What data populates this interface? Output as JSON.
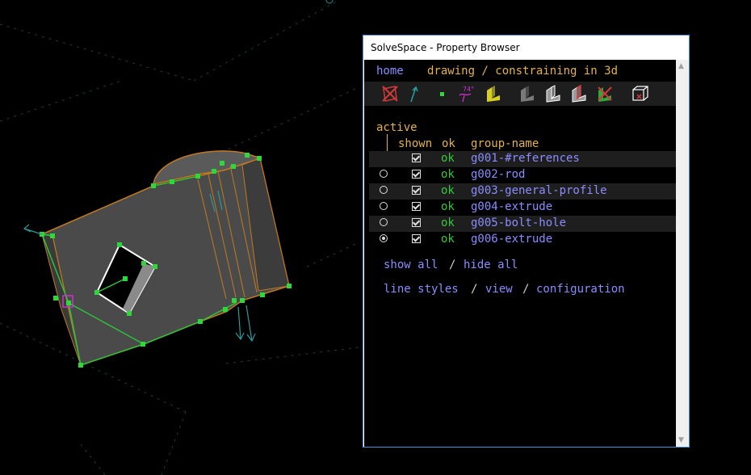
{
  "window": {
    "title": "SolveSpace - Property Browser"
  },
  "nav": {
    "home": "home",
    "title": "drawing / constraining in 3d"
  },
  "toolbar": {
    "icons": [
      "show-workplanes",
      "show-normals",
      "show-points",
      "show-constraints",
      "show-faces",
      "show-shaded",
      "show-edges",
      "show-outline",
      "show-hidden-lines",
      "show-mesh",
      "show-bounding-box"
    ],
    "constraint_glyph": "74°"
  },
  "groups_table": {
    "active_label": "active",
    "headers": {
      "shown": "shown",
      "ok": "ok",
      "name": "group-name"
    },
    "rows": [
      {
        "active": "ref",
        "shown": true,
        "ok": "ok",
        "name": "g001-#references"
      },
      {
        "active": false,
        "shown": true,
        "ok": "ok",
        "name": "g002-rod"
      },
      {
        "active": false,
        "shown": true,
        "ok": "ok",
        "name": "g003-general-profile"
      },
      {
        "active": false,
        "shown": true,
        "ok": "ok",
        "name": "g004-extrude"
      },
      {
        "active": false,
        "shown": true,
        "ok": "ok",
        "name": "g005-bolt-hole"
      },
      {
        "active": true,
        "shown": true,
        "ok": "ok",
        "name": "g006-extrude"
      }
    ]
  },
  "links": {
    "show_all": "show all",
    "slash": "/",
    "hide_all": "hide all",
    "line_styles": "line styles",
    "view": "view",
    "configuration": "configuration"
  },
  "colors": {
    "link": "#8c8cff",
    "heading": "#e3b24f",
    "ok": "#39c83c",
    "window_border": "#4a8fd8"
  }
}
